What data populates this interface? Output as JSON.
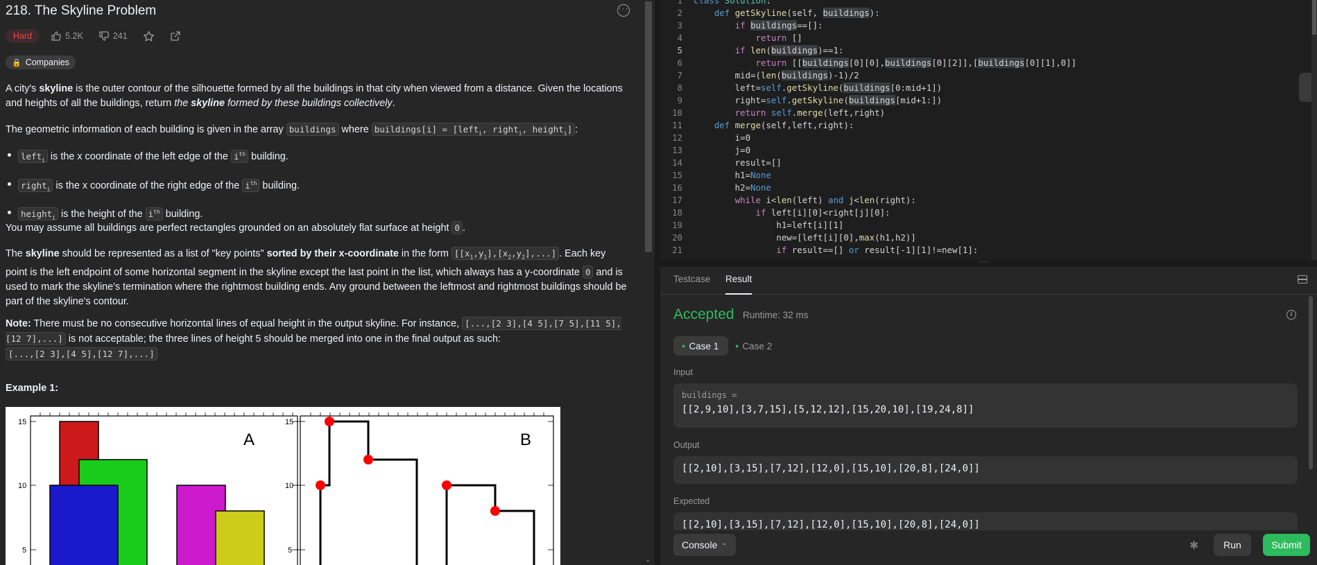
{
  "problem": {
    "title": "218. The Skyline Problem",
    "difficulty": "Hard",
    "likes": "5.2K",
    "dislikes": "241",
    "companies_label": "Companies"
  },
  "description": {
    "p1_a": "A city's ",
    "p1_b": "skyline",
    "p1_c": " is the outer contour of the silhouette formed by all the buildings in that city when viewed from a distance. Given the locations and heights of all the buildings, return ",
    "p1_d": "the ",
    "p1_e": "skyline",
    "p1_f": " formed by these buildings collectively",
    "p1_g": ".",
    "p2_a": "The geometric information of each building is given in the array ",
    "p2_code1": "buildings",
    "p2_b": " where ",
    "p2_code2": "buildings[i] = [lefti, righti, heighti]",
    "p2_c": ":",
    "bullets": [
      {
        "code": "lefti",
        "text_a": " is the x coordinate of the left edge of the ",
        "code2": "ith",
        "text_b": " building."
      },
      {
        "code": "righti",
        "text_a": " is the x coordinate of the right edge of the ",
        "code2": "ith",
        "text_b": " building."
      },
      {
        "code": "heighti",
        "text_a": " is the height of the ",
        "code2": "ith",
        "text_b": " building."
      }
    ],
    "p3_a": "You may assume all buildings are perfect rectangles grounded on an absolutely flat surface at height ",
    "p3_code": "0",
    "p3_b": ".",
    "p4_a": "The ",
    "p4_b": "skyline",
    "p4_c": " should be represented as a list of \"key points\" ",
    "p4_d": "sorted by their x-coordinate",
    "p4_e": " in the form ",
    "p4_code": "[[x1,y1],[x2,y2],...]",
    "p4_f": ". Each key point is the left endpoint of some horizontal segment in the skyline except the last point in the list, which always has a y-coordinate ",
    "p4_code2": "0",
    "p4_g": " and is used to mark the skyline's termination where the rightmost building ends. Any ground between the leftmost and rightmost buildings should be part of the skyline's contour.",
    "p5_a": "Note:",
    "p5_b": " There must be no consecutive horizontal lines of equal height in the output skyline. For instance, ",
    "p5_code": "[...,[2 3],[4 5],[7 5],[11 5],[12 7],...]",
    "p5_c": " is not acceptable; the three lines of height 5 should be merged into one in the final output as such: ",
    "p5_code2": "[...,[2 3],[4 5],[12 7],...]",
    "example_title": "Example 1:"
  },
  "figure": {
    "label_a": "A",
    "label_b": "B",
    "tick_15": "15",
    "tick_10": "10",
    "tick_5": "5"
  },
  "editor": {
    "lines": [
      {
        "n": "1",
        "html": "<span class='kw2'>class</span> <span class='cls'>Solution</span>:"
      },
      {
        "n": "2",
        "html": "    <span class='kw2'>def</span> <span class='fn'>getSkyline</span>(self, <span class='hl'>buildings</span>):"
      },
      {
        "n": "3",
        "html": "        <span class='kw'>if</span> <span class='hl'>buildings</span>==[]:"
      },
      {
        "n": "4",
        "html": "            <span class='kw'>return</span> []"
      },
      {
        "n": "5",
        "html": "        <span class='kw'>if</span> <span class='fn'>len</span>(<span class='hl'>buildings</span>)==1:"
      },
      {
        "n": "6",
        "html": "            <span class='kw'>return</span> [[<span class='hl'>buildings</span>[0][0],<span class='hl'>buildings</span>[0][2]],[<span class='hl'>buildings</span>[0][1],0]]"
      },
      {
        "n": "7",
        "html": "        mid=(<span class='fn'>len</span>(<span class='hl'>buildings</span>)-1)/2"
      },
      {
        "n": "8",
        "html": "        left=<span class='kw2'>self</span>.<span class='fn'>getSkyline</span>(<span class='hl'>buildings</span>[0:mid+1])"
      },
      {
        "n": "9",
        "html": "        right=<span class='kw2'>self</span>.<span class='fn'>getSkyline</span>(<span class='hl'>buildings</span>[mid+1:])"
      },
      {
        "n": "10",
        "html": "        <span class='kw'>return</span> <span class='kw2'>self</span>.<span class='fn'>merge</span>(left,right)"
      },
      {
        "n": "11",
        "html": "    <span class='kw2'>def</span> <span class='fn'>merge</span>(self,left,right):"
      },
      {
        "n": "12",
        "html": "        i=0"
      },
      {
        "n": "13",
        "html": "        j=0"
      },
      {
        "n": "14",
        "html": "        result=[]"
      },
      {
        "n": "15",
        "html": "        h1=<span class='kw2'>None</span>"
      },
      {
        "n": "16",
        "html": "        h2=<span class='kw2'>None</span>"
      },
      {
        "n": "17",
        "html": "        <span class='kw'>while</span> i&lt;<span class='fn'>len</span>(left) <span class='kw2'>and</span> j&lt;<span class='fn'>len</span>(right):"
      },
      {
        "n": "18",
        "html": "            <span class='kw'>if</span> left[i][0]&lt;right[j][0]:"
      },
      {
        "n": "19",
        "html": "                h1=left[i][1]"
      },
      {
        "n": "20",
        "html": "                new=[left[i][0],<span class='fn'>max</span>(h1,h2)]"
      },
      {
        "n": "21",
        "html": "                <span class='kw'>if</span> result==[] <span class='kw2'>or</span> result[-1][1]!=new[1]:"
      }
    ],
    "current_line": "5"
  },
  "console": {
    "tab_testcase": "Testcase",
    "tab_result": "Result",
    "status": "Accepted",
    "runtime": "Runtime: 32 ms",
    "case1": "Case 1",
    "case2": "Case 2",
    "input_label": "Input",
    "input_var": "buildings =",
    "input_value": "[[2,9,10],[3,7,15],[5,12,12],[15,20,10],[19,24,8]]",
    "output_label": "Output",
    "output_value": "[[2,10],[3,15],[7,12],[12,0],[15,10],[20,8],[24,0]]",
    "expected_label": "Expected",
    "expected_value": "[[2,10],[3,15],[7,12],[12,0],[15,10],[20,8],[24,0]]",
    "console_button": "Console",
    "run_button": "Run",
    "submit_button": "Submit"
  },
  "colors": {
    "accepted": "#2cbb5d",
    "hard": "#ef4743",
    "building_red": "#cc1a1a",
    "building_green": "#1acc1a",
    "building_blue": "#1a1acc",
    "building_magenta": "#cc1acc",
    "building_yellow": "#cccc1a"
  }
}
